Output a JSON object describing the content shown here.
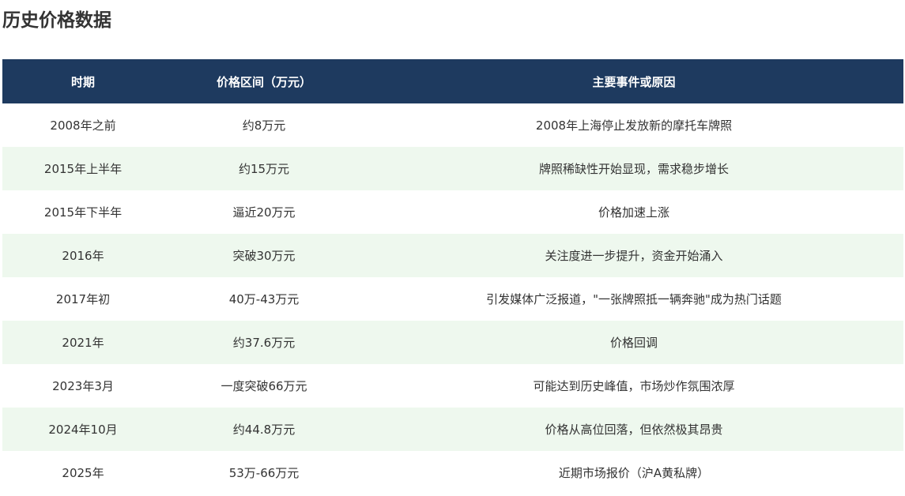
{
  "page": {
    "title": "历史价格数据"
  },
  "table": {
    "headers": [
      "时期",
      "价格区间（万元）",
      "主要事件或原因"
    ],
    "rows": [
      [
        "2008年之前",
        "约8万元",
        "2008年上海停止发放新的摩托车牌照"
      ],
      [
        "2015年上半年",
        "约15万元",
        "牌照稀缺性开始显现，需求稳步增长"
      ],
      [
        "2015年下半年",
        "逼近20万元",
        "价格加速上涨"
      ],
      [
        "2016年",
        "突破30万元",
        "关注度进一步提升，资金开始涌入"
      ],
      [
        "2017年初",
        "40万-43万元",
        "引发媒体广泛报道，\"一张牌照抵一辆奔驰\"成为热门话题"
      ],
      [
        "2021年",
        "约37.6万元",
        "价格回调"
      ],
      [
        "2023年3月",
        "一度突破66万元",
        "可能达到历史峰值，市场炒作氛围浓厚"
      ],
      [
        "2024年10月",
        "约44.8万元",
        "价格从高位回落，但依然极其昂贵"
      ],
      [
        "2025年",
        "53万-66万元",
        "近期市场报价（沪A黄私牌）"
      ]
    ]
  },
  "colors": {
    "header_bg": "#1e3a5f",
    "header_text": "#ffffff",
    "row_alt_bg": "#eef8ee",
    "text": "#333333"
  }
}
